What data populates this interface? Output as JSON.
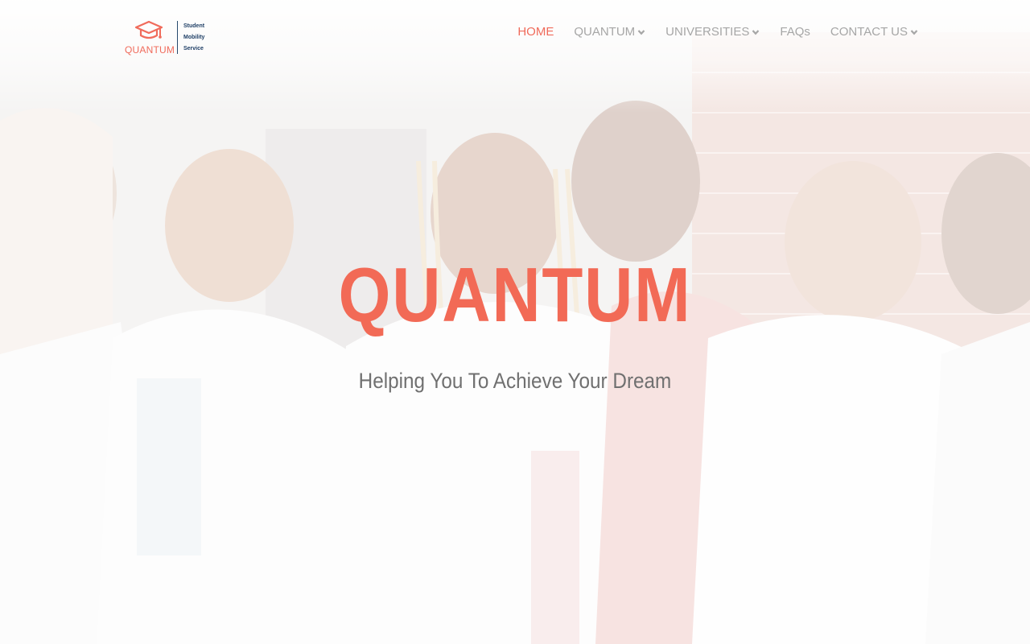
{
  "brand": {
    "wordmark": "QUANTUM",
    "tagline": [
      "Student",
      "Mobility",
      "Service"
    ],
    "icon": "graduation-cap-icon",
    "colors": {
      "accent": "#f06b5b",
      "navy": "#1f3f66"
    }
  },
  "nav": {
    "items": [
      {
        "label": "HOME",
        "active": true,
        "has_dropdown": false
      },
      {
        "label": "QUANTUM",
        "active": false,
        "has_dropdown": true
      },
      {
        "label": "UNIVERSITIES",
        "active": false,
        "has_dropdown": true
      },
      {
        "label": "FAQs",
        "active": false,
        "has_dropdown": false
      },
      {
        "label": "CONTACT US",
        "active": false,
        "has_dropdown": true
      }
    ],
    "dropdown_icon": "chevron-down-icon",
    "colors": {
      "inactive": "#a6a6a6",
      "active": "#f06b5b"
    }
  },
  "hero": {
    "title": "QUANTUM",
    "subtitle": "Helping You To Achieve Your Dream"
  }
}
